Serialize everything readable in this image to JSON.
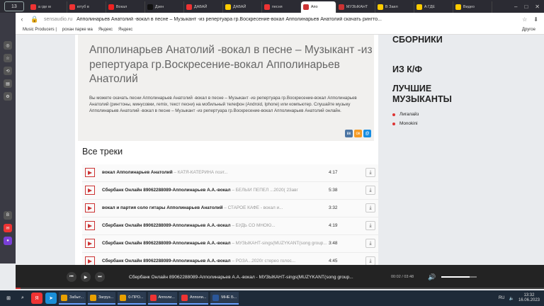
{
  "browser": {
    "tab_count": "13",
    "tabs": [
      {
        "label": "а где м",
        "color": "#e33"
      },
      {
        "label": "ютуб в",
        "color": "#e33"
      },
      {
        "label": "Вокал",
        "color": "#e22"
      },
      {
        "label": "Дзен",
        "color": "#111"
      },
      {
        "label": "ДАВАЙ",
        "color": "#e33"
      },
      {
        "label": "ДАВАЙ",
        "color": "#fc0"
      },
      {
        "label": "песня",
        "color": "#e33"
      },
      {
        "label": "Апо",
        "color": "#c33",
        "active": true
      },
      {
        "label": "МУЗЫКАНТ",
        "color": "#c33"
      },
      {
        "label": "В Заил",
        "color": "#fc0"
      },
      {
        "label": "А ГДЕ",
        "color": "#fc0"
      },
      {
        "label": "Видео",
        "color": "#fc0"
      }
    ],
    "url_domain": "sensaudio.ru",
    "url_title": "Апполинарьев Анатолий -вокал в песне – Музыкант -из репертуара гр.Воскресение-вокал Апполинарьев Анатолий скачать рингто...",
    "bookmarks": [
      "Music Producers |",
      "рохан парке ма",
      "Яндекс",
      "Яндекс"
    ],
    "other_bookmarks": "Другое"
  },
  "page": {
    "heading": "Апполинарьев Анатолий -вокал в песне – Музыкант -из репертуара гр.Воскресение-вокал Апполинарьев Анатолий",
    "description": "Вы можете скачать песни Апполинарьев Анатолий -вокал в песне – Музыкант -из репертуара гр.Воскресение-вокал Апполинарьев Анатолий (рингтоны, минусовки, remix, текст песни) на мобильный телефон (Android, Iphone) или компьютер. Слушайте музыку Апполинарьев Анатолий -вокал в песне – Музыкант -из репертуара гр.Воскресение-вокал Апполинарьев Анатолий онлайн.",
    "share": [
      {
        "label": "вк",
        "color": "#4c75a3"
      },
      {
        "label": "ок",
        "color": "#f59a23"
      },
      {
        "label": "@",
        "color": "#168de2"
      }
    ],
    "tracks_heading": "Все треки",
    "tracks": [
      {
        "artist": "вокал Апполинарьев Анатолий",
        "title": "КАТЯ-КАТЕРИНА поэт...",
        "duration": "4:17"
      },
      {
        "artist": "Сбербанк Онлайн 89062288089-Апполинарьев А.А.-вокал",
        "title": "БЕЛЫЙ ПЕПЕЛ ...2020( 23авг",
        "duration": "5:38"
      },
      {
        "artist": "вокал и партия соло гитары Апполинарьев Анатолий",
        "title": "СТАРОЕ КАФЕ - вокал и...",
        "duration": "3:32"
      },
      {
        "artist": "Сбербанк Онлайн 89062288089-Апполинарьев А.А.-вокал",
        "title": "БУДЬ СО МНОЮ...",
        "duration": "4:19"
      },
      {
        "artist": "Сбербанк Онлайн 89062288089-Апполинарьев А.А.-вокал",
        "title": "МУЗЫКАНТ-sings(MUZYKANT(song group...",
        "duration": "3:48"
      },
      {
        "artist": "Сбербанк Онлайн 89062288089-Апполинарьев А.А.-вокал",
        "title": "РОЗА...2020г стерео голос...",
        "duration": "4:45"
      }
    ],
    "track_separator": " – "
  },
  "right_column": {
    "headings": [
      "СБОРНИКИ",
      "ИЗ К/Ф",
      "ЛУЧШИЕ МУЗЫКАНТЫ"
    ],
    "items": [
      "Лигалайз",
      "Monokini"
    ]
  },
  "player": {
    "title": "Сбербанк Онлайн 89062288089-Апполинарьев А.А.-вокал - МУЗЫКАНТ-sings(MUZYKANT(song group...",
    "time": "00:02 / 03:48",
    "progress": 0.01,
    "volume": 0.8
  },
  "taskbar": {
    "apps": [
      {
        "label": "Забыт...",
        "color": "#e8a000"
      },
      {
        "label": "Загруз...",
        "color": "#e8a000"
      },
      {
        "label": "0-ПРО...",
        "color": "#e8a000"
      },
      {
        "label": "Апполи...",
        "color": "#e33"
      },
      {
        "label": "Апполи...",
        "color": "#e33"
      },
      {
        "label": "МНЕ Б...",
        "color": "#2b579a"
      }
    ],
    "lang": "RU",
    "time": "13:32",
    "date": "16.06.2023"
  }
}
